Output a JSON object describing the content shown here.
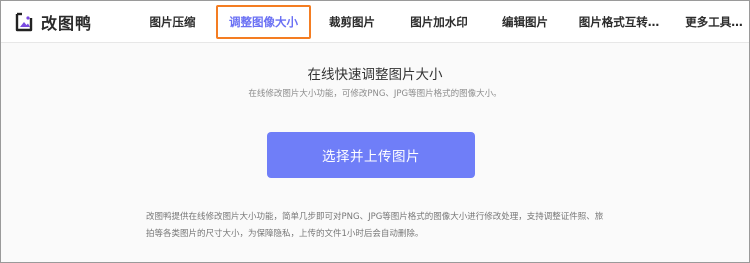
{
  "brand": {
    "name": "改图鸭",
    "logo_icon": "image-logo-icon"
  },
  "nav": {
    "items": [
      {
        "label": "图片压缩",
        "active": false
      },
      {
        "label": "调整图像大小",
        "active": true
      },
      {
        "label": "裁剪图片",
        "active": false
      },
      {
        "label": "图片加水印",
        "active": false
      },
      {
        "label": "编辑图片",
        "active": false
      },
      {
        "label": "图片格式互转…",
        "active": false
      },
      {
        "label": "更多工具…",
        "active": false
      }
    ]
  },
  "main": {
    "title": "在线快速调整图片大小",
    "subtitle": "在线修改图片大小功能，可修改PNG、JPG等图片格式的图像大小。",
    "upload_button": "选择并上传图片",
    "description": [
      "改图鸭提供在线修改图片大小功能，简单几步即可对PNG、JPG等图片格式的图像大小进行修改处理，支持调整证件照、旅",
      "拍等各类图片的尺寸大小，为保障隐私，上传的文件1小时后会自动删除。"
    ]
  },
  "colors": {
    "accent": "#6f7ef8",
    "active_nav_text": "#6a70f4",
    "active_nav_border": "#f47d22",
    "content_bg": "#fafafa"
  }
}
